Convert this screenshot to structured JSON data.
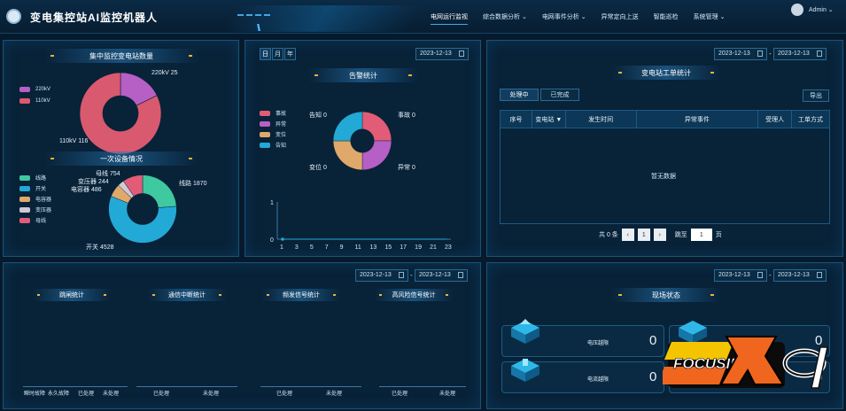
{
  "header": {
    "title": "变电集控站AI监控机器人",
    "nav": [
      "电网运行监视",
      "综合数据分析",
      "电网事件分析",
      "异常定向上送",
      "智能巡检",
      "系统管理"
    ],
    "user": "Admin"
  },
  "station_panel": {
    "title": "集中监控变电站数量",
    "chart_data": {
      "type": "pie",
      "categories": [
        "220kV",
        "110kV"
      ],
      "values": [
        25,
        116
      ],
      "colors": [
        "#b65fc4",
        "#d9596f"
      ]
    },
    "label_220": "220kV 25",
    "label_110": "110kV 116"
  },
  "equip_panel": {
    "title": "一次设备情况",
    "chart_data": {
      "type": "pie",
      "categories": [
        "线路",
        "开关",
        "电容器",
        "变压器",
        "母线"
      ],
      "values": [
        1870,
        4528,
        486,
        244,
        754
      ],
      "colors": [
        "#3ec9a0",
        "#23a9d6",
        "#e0a86a",
        "#cfc9d6",
        "#e25c78"
      ]
    },
    "labels": [
      "线路 1870",
      "开关 4528",
      "电容器 486",
      "变压器 244",
      "母线 754"
    ]
  },
  "alarm_panel": {
    "tabs": [
      "日",
      "月",
      "年"
    ],
    "date": "2023-12-13",
    "title": "告警统计",
    "chart_data": {
      "type": "pie",
      "categories": [
        "事故",
        "异常",
        "变位",
        "告知"
      ],
      "values": [
        0,
        0,
        0,
        0
      ],
      "colors": [
        "#e25c78",
        "#b65fc4",
        "#e0a86a",
        "#23a9d6"
      ]
    },
    "labels": [
      "事故 0",
      "异常 0",
      "变位 0",
      "告知 0"
    ],
    "line_chart": {
      "type": "line",
      "x": [
        1,
        3,
        5,
        7,
        9,
        11,
        13,
        15,
        17,
        19,
        21,
        23
      ],
      "y_ticks": [
        0,
        1
      ],
      "values": [
        0,
        0,
        0,
        0,
        0,
        0,
        0,
        0,
        0,
        0,
        0,
        0
      ]
    }
  },
  "workorder_panel": {
    "date_from": "2023-12-13",
    "date_to": "2023-12-13",
    "title": "变电站工单统计",
    "tabs": [
      "处理中",
      "已完成"
    ],
    "export": "导出",
    "columns": [
      "序号",
      "变电站",
      "发生时间",
      "异常事件",
      "受理人",
      "工单方式"
    ],
    "empty": "暂无数据",
    "pager": {
      "total": "共 0 条",
      "page": "1",
      "jump": "跳至",
      "page_suffix": "页",
      "prev": "‹",
      "next": "›"
    }
  },
  "stats_panel": {
    "date_from": "2023-12-13",
    "date_to": "2023-12-13",
    "groups": [
      {
        "title": "跳闸统计",
        "cats": [
          "瞬时故障",
          "永久故障",
          "已处理",
          "未处理"
        ]
      },
      {
        "title": "通信中断统计",
        "cats": [
          "已处理",
          "未处理"
        ]
      },
      {
        "title": "频发信号统计",
        "cats": [
          "已处理",
          "未处理"
        ]
      },
      {
        "title": "高风险信号统计",
        "cats": [
          "已处理",
          "未处理"
        ]
      }
    ]
  },
  "site_panel": {
    "date_from": "2023-12-13",
    "date_to": "2023-12-13",
    "title": "现场状态",
    "cards": [
      {
        "label": "电压越限",
        "value": "0"
      },
      {
        "label": "电流越限",
        "value": "0"
      },
      {
        "label": "",
        "value": "0"
      },
      {
        "label": "",
        "value": "0"
      }
    ],
    "partial_label": "称"
  },
  "watermark": {
    "text": "FOCUSING"
  }
}
